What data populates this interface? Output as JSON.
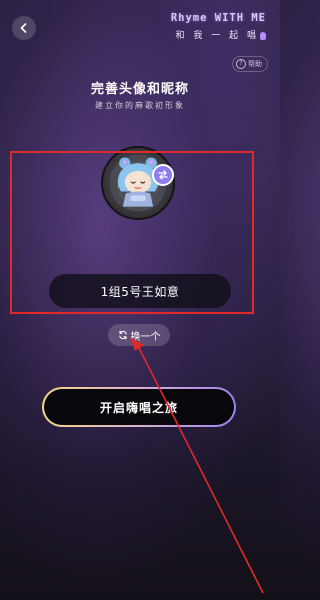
{
  "header": {
    "back_icon": "chevron-left-icon",
    "brand_title": "Rhyme WITH ME",
    "brand_subtitle": "和 我 一 起 唱",
    "brand_icon": "microphone-icon",
    "help_label": "帮助",
    "help_icon": "question-circle-icon"
  },
  "page": {
    "title": "完善头像和昵称",
    "subtitle": "建立你的麻歌初形象"
  },
  "profile": {
    "avatar": "cartoon-girl-avatar",
    "swap_icon": "swap-arrows-icon",
    "nickname": "1组5号王如意",
    "shuffle_label": "换一个",
    "shuffle_icon": "refresh-icon"
  },
  "actions": {
    "start_label": "开启嗨唱之旅"
  },
  "colors": {
    "annotation_red": "#e02a2a",
    "accent_purple": "#8f7cf0",
    "button_gradient_start": "#f4d97e",
    "button_gradient_end": "#9b84ee"
  }
}
